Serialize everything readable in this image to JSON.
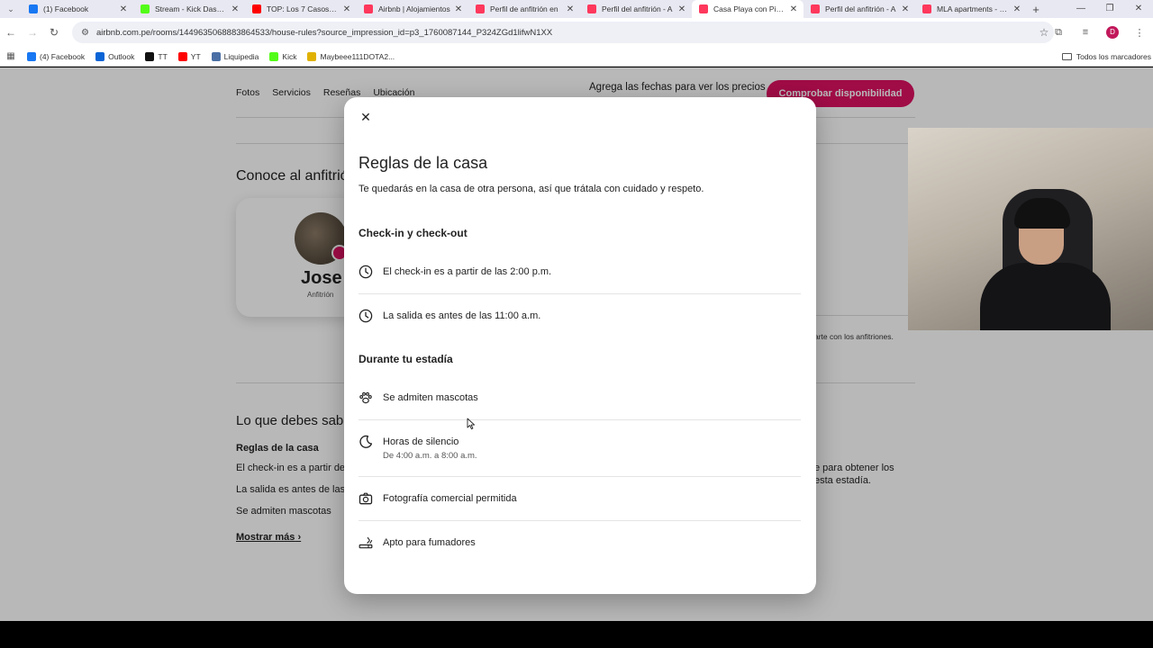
{
  "browser": {
    "tabs": [
      {
        "title": "(1) Facebook",
        "color": "#1877f2",
        "active": false
      },
      {
        "title": "Stream - Kick Dashboard",
        "color": "#53fc18",
        "active": false
      },
      {
        "title": "TOP: Los 7 Casos de",
        "color": "#ff0000",
        "active": false
      },
      {
        "title": "Airbnb | Alojamientos",
        "color": "#ff385c",
        "active": false
      },
      {
        "title": "Perfil de anfitrión en",
        "color": "#ff385c",
        "active": false
      },
      {
        "title": "Perfil del anfitrión - A",
        "color": "#ff385c",
        "active": false
      },
      {
        "title": "Casa Playa con Piscina",
        "color": "#ff385c",
        "active": true
      },
      {
        "title": "Perfil del anfitrión - A",
        "color": "#ff385c",
        "active": false
      },
      {
        "title": "MLA apartments - Re",
        "color": "#ff385c",
        "active": false
      }
    ],
    "url": "airbnb.com.pe/rooms/1449635068883864533/house-rules?source_impression_id=p3_1760087144_P324ZGd1lifwN1XX",
    "profile_initial": "D",
    "bookmarks": [
      {
        "label": "(4) Facebook",
        "color": "#1877f2"
      },
      {
        "label": "Outlook",
        "color": "#0a64d6"
      },
      {
        "label": "TT",
        "color": "#111111"
      },
      {
        "label": "YT",
        "color": "#ff0000"
      },
      {
        "label": "Liquipedia",
        "color": "#4a6fa5"
      },
      {
        "label": "Kick",
        "color": "#53fc18"
      },
      {
        "label": "Maybeee111DOTA2...",
        "color": "#e0b100"
      }
    ],
    "all_bookmarks_label": "Todos los marcadores"
  },
  "page": {
    "subnav": [
      "Fotos",
      "Servicios",
      "Reseñas",
      "Ubicación"
    ],
    "price_hint": "Agrega las fechas para ver los precios",
    "check_button": "Comprobar disponibilidad",
    "host_section_title": "Conoce al anfitrió",
    "host_name": "Jose",
    "host_role": "Anfitrión",
    "right_note": "arte con los anfitriones.",
    "know_title": "Lo que debes sabe",
    "rules_subtitle": "Reglas de la casa",
    "rules_preview": [
      "El check-in es a partir de",
      "La salida es antes de las",
      "Se admiten mascotas"
    ],
    "show_more": "Mostrar más",
    "right_paragraph": "e para obtener los esta estadía."
  },
  "modal": {
    "title": "Reglas de la casa",
    "subtitle": "Te quedarás en la casa de otra persona, así que trátala con cuidado y respeto.",
    "sections": [
      {
        "heading": "Check-in y check-out",
        "rules": [
          {
            "icon": "clock-icon",
            "text": "El check-in es a partir de las 2:00 p.m."
          },
          {
            "icon": "clock-icon",
            "text": "La salida es antes de las 11:00 a.m."
          }
        ]
      },
      {
        "heading": "Durante tu estadía",
        "rules": [
          {
            "icon": "paw-icon",
            "text": "Se admiten mascotas"
          },
          {
            "icon": "moon-icon",
            "text": "Horas de silencio",
            "detail": "De 4:00 a.m. a 8:00 a.m."
          },
          {
            "icon": "camera-icon",
            "text": "Fotografía comercial permitida"
          },
          {
            "icon": "smoking-icon",
            "text": "Apto para fumadores"
          }
        ]
      }
    ]
  },
  "colors": {
    "brand": "#de1162"
  }
}
